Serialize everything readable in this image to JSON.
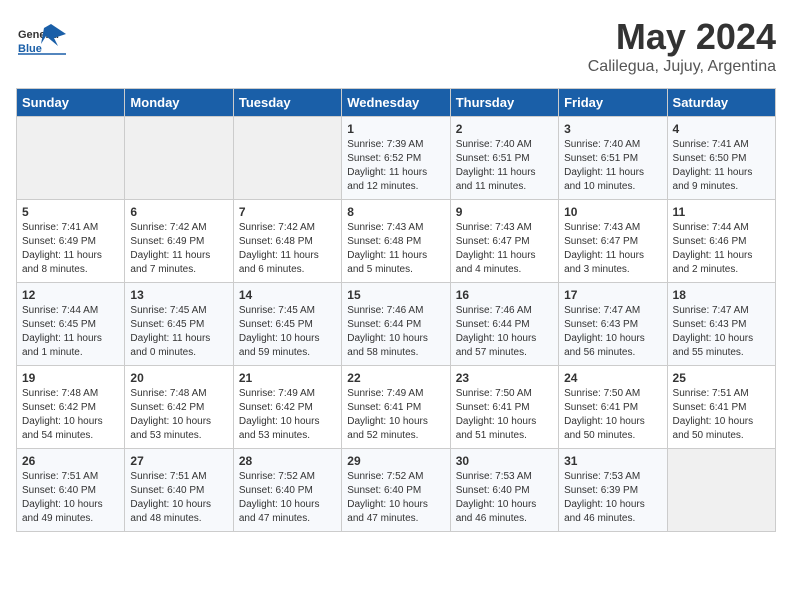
{
  "header": {
    "logo_general": "General",
    "logo_blue": "Blue",
    "month": "May 2024",
    "location": "Calilegua, Jujuy, Argentina"
  },
  "weekdays": [
    "Sunday",
    "Monday",
    "Tuesday",
    "Wednesday",
    "Thursday",
    "Friday",
    "Saturday"
  ],
  "weeks": [
    [
      {
        "day": "",
        "info": ""
      },
      {
        "day": "",
        "info": ""
      },
      {
        "day": "",
        "info": ""
      },
      {
        "day": "1",
        "info": "Sunrise: 7:39 AM\nSunset: 6:52 PM\nDaylight: 11 hours and 12 minutes."
      },
      {
        "day": "2",
        "info": "Sunrise: 7:40 AM\nSunset: 6:51 PM\nDaylight: 11 hours and 11 minutes."
      },
      {
        "day": "3",
        "info": "Sunrise: 7:40 AM\nSunset: 6:51 PM\nDaylight: 11 hours and 10 minutes."
      },
      {
        "day": "4",
        "info": "Sunrise: 7:41 AM\nSunset: 6:50 PM\nDaylight: 11 hours and 9 minutes."
      }
    ],
    [
      {
        "day": "5",
        "info": "Sunrise: 7:41 AM\nSunset: 6:49 PM\nDaylight: 11 hours and 8 minutes."
      },
      {
        "day": "6",
        "info": "Sunrise: 7:42 AM\nSunset: 6:49 PM\nDaylight: 11 hours and 7 minutes."
      },
      {
        "day": "7",
        "info": "Sunrise: 7:42 AM\nSunset: 6:48 PM\nDaylight: 11 hours and 6 minutes."
      },
      {
        "day": "8",
        "info": "Sunrise: 7:43 AM\nSunset: 6:48 PM\nDaylight: 11 hours and 5 minutes."
      },
      {
        "day": "9",
        "info": "Sunrise: 7:43 AM\nSunset: 6:47 PM\nDaylight: 11 hours and 4 minutes."
      },
      {
        "day": "10",
        "info": "Sunrise: 7:43 AM\nSunset: 6:47 PM\nDaylight: 11 hours and 3 minutes."
      },
      {
        "day": "11",
        "info": "Sunrise: 7:44 AM\nSunset: 6:46 PM\nDaylight: 11 hours and 2 minutes."
      }
    ],
    [
      {
        "day": "12",
        "info": "Sunrise: 7:44 AM\nSunset: 6:45 PM\nDaylight: 11 hours and 1 minute."
      },
      {
        "day": "13",
        "info": "Sunrise: 7:45 AM\nSunset: 6:45 PM\nDaylight: 11 hours and 0 minutes."
      },
      {
        "day": "14",
        "info": "Sunrise: 7:45 AM\nSunset: 6:45 PM\nDaylight: 10 hours and 59 minutes."
      },
      {
        "day": "15",
        "info": "Sunrise: 7:46 AM\nSunset: 6:44 PM\nDaylight: 10 hours and 58 minutes."
      },
      {
        "day": "16",
        "info": "Sunrise: 7:46 AM\nSunset: 6:44 PM\nDaylight: 10 hours and 57 minutes."
      },
      {
        "day": "17",
        "info": "Sunrise: 7:47 AM\nSunset: 6:43 PM\nDaylight: 10 hours and 56 minutes."
      },
      {
        "day": "18",
        "info": "Sunrise: 7:47 AM\nSunset: 6:43 PM\nDaylight: 10 hours and 55 minutes."
      }
    ],
    [
      {
        "day": "19",
        "info": "Sunrise: 7:48 AM\nSunset: 6:42 PM\nDaylight: 10 hours and 54 minutes."
      },
      {
        "day": "20",
        "info": "Sunrise: 7:48 AM\nSunset: 6:42 PM\nDaylight: 10 hours and 53 minutes."
      },
      {
        "day": "21",
        "info": "Sunrise: 7:49 AM\nSunset: 6:42 PM\nDaylight: 10 hours and 53 minutes."
      },
      {
        "day": "22",
        "info": "Sunrise: 7:49 AM\nSunset: 6:41 PM\nDaylight: 10 hours and 52 minutes."
      },
      {
        "day": "23",
        "info": "Sunrise: 7:50 AM\nSunset: 6:41 PM\nDaylight: 10 hours and 51 minutes."
      },
      {
        "day": "24",
        "info": "Sunrise: 7:50 AM\nSunset: 6:41 PM\nDaylight: 10 hours and 50 minutes."
      },
      {
        "day": "25",
        "info": "Sunrise: 7:51 AM\nSunset: 6:41 PM\nDaylight: 10 hours and 50 minutes."
      }
    ],
    [
      {
        "day": "26",
        "info": "Sunrise: 7:51 AM\nSunset: 6:40 PM\nDaylight: 10 hours and 49 minutes."
      },
      {
        "day": "27",
        "info": "Sunrise: 7:51 AM\nSunset: 6:40 PM\nDaylight: 10 hours and 48 minutes."
      },
      {
        "day": "28",
        "info": "Sunrise: 7:52 AM\nSunset: 6:40 PM\nDaylight: 10 hours and 47 minutes."
      },
      {
        "day": "29",
        "info": "Sunrise: 7:52 AM\nSunset: 6:40 PM\nDaylight: 10 hours and 47 minutes."
      },
      {
        "day": "30",
        "info": "Sunrise: 7:53 AM\nSunset: 6:40 PM\nDaylight: 10 hours and 46 minutes."
      },
      {
        "day": "31",
        "info": "Sunrise: 7:53 AM\nSunset: 6:39 PM\nDaylight: 10 hours and 46 minutes."
      },
      {
        "day": "",
        "info": ""
      }
    ]
  ]
}
